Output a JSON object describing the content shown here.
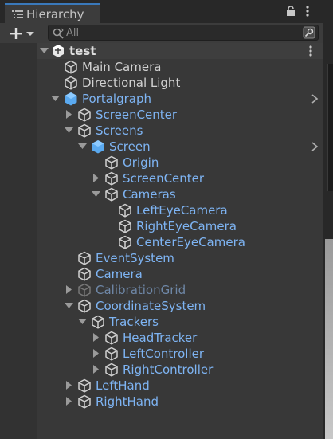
{
  "window": {
    "tab_title": "Hierarchy"
  },
  "search": {
    "placeholder": "All",
    "value": ""
  },
  "scene": {
    "name": "test"
  },
  "colors": {
    "text_normal": "#d2d2d2",
    "text_prefab": "#7eb4f3",
    "text_disabled": "#6f88a8",
    "accent_tab": "#3a79bb",
    "prefab_cube": "#5aa9ef"
  },
  "tree": [
    {
      "label": "Main Camera",
      "depth": 0,
      "arrow": "none",
      "icon": "gameobject-cube-icon",
      "style": "normal",
      "chevron": false
    },
    {
      "label": "Directional Light",
      "depth": 0,
      "arrow": "none",
      "icon": "gameobject-cube-icon",
      "style": "normal",
      "chevron": false
    },
    {
      "label": "Portalgraph",
      "depth": 0,
      "arrow": "expanded",
      "icon": "prefab-cube-icon",
      "style": "prefab",
      "chevron": true
    },
    {
      "label": "ScreenCenter",
      "depth": 1,
      "arrow": "collapsed",
      "icon": "gameobject-cube-icon",
      "style": "prefab",
      "chevron": false
    },
    {
      "label": "Screens",
      "depth": 1,
      "arrow": "expanded",
      "icon": "gameobject-cube-icon",
      "style": "prefab",
      "chevron": false
    },
    {
      "label": "Screen",
      "depth": 2,
      "arrow": "expanded",
      "icon": "prefab-cube-icon",
      "style": "prefab",
      "chevron": true
    },
    {
      "label": "Origin",
      "depth": 3,
      "arrow": "none",
      "icon": "gameobject-cube-icon",
      "style": "prefab",
      "chevron": false
    },
    {
      "label": "ScreenCenter",
      "depth": 3,
      "arrow": "collapsed",
      "icon": "gameobject-cube-icon",
      "style": "prefab",
      "chevron": false
    },
    {
      "label": "Cameras",
      "depth": 3,
      "arrow": "expanded",
      "icon": "gameobject-cube-icon",
      "style": "prefab",
      "chevron": false
    },
    {
      "label": "LeftEyeCamera",
      "depth": 4,
      "arrow": "none",
      "icon": "gameobject-cube-icon",
      "style": "prefab",
      "chevron": false
    },
    {
      "label": "RightEyeCamera",
      "depth": 4,
      "arrow": "none",
      "icon": "gameobject-cube-icon",
      "style": "prefab",
      "chevron": false
    },
    {
      "label": "CenterEyeCamera",
      "depth": 4,
      "arrow": "none",
      "icon": "gameobject-cube-icon",
      "style": "prefab",
      "chevron": false
    },
    {
      "label": "EventSystem",
      "depth": 1,
      "arrow": "none",
      "icon": "gameobject-cube-icon",
      "style": "prefab",
      "chevron": false
    },
    {
      "label": "Camera",
      "depth": 1,
      "arrow": "none",
      "icon": "gameobject-cube-icon",
      "style": "prefab",
      "chevron": false
    },
    {
      "label": "CalibrationGrid",
      "depth": 1,
      "arrow": "collapsed",
      "icon": "gameobject-cube-icon",
      "style": "disabled",
      "chevron": false
    },
    {
      "label": "CoordinateSystem",
      "depth": 1,
      "arrow": "expanded",
      "icon": "gameobject-cube-icon",
      "style": "prefab",
      "chevron": false
    },
    {
      "label": "Trackers",
      "depth": 2,
      "arrow": "expanded",
      "icon": "gameobject-cube-icon",
      "style": "prefab",
      "chevron": false
    },
    {
      "label": "HeadTracker",
      "depth": 3,
      "arrow": "collapsed",
      "icon": "gameobject-cube-icon",
      "style": "prefab",
      "chevron": false
    },
    {
      "label": "LeftController",
      "depth": 3,
      "arrow": "collapsed",
      "icon": "gameobject-cube-icon",
      "style": "prefab",
      "chevron": false
    },
    {
      "label": "RightController",
      "depth": 3,
      "arrow": "collapsed",
      "icon": "gameobject-cube-icon",
      "style": "prefab",
      "chevron": false
    },
    {
      "label": "LeftHand",
      "depth": 1,
      "arrow": "collapsed",
      "icon": "gameobject-cube-icon",
      "style": "prefab",
      "chevron": false
    },
    {
      "label": "RightHand",
      "depth": 1,
      "arrow": "collapsed",
      "icon": "gameobject-cube-icon",
      "style": "prefab",
      "chevron": false
    }
  ]
}
